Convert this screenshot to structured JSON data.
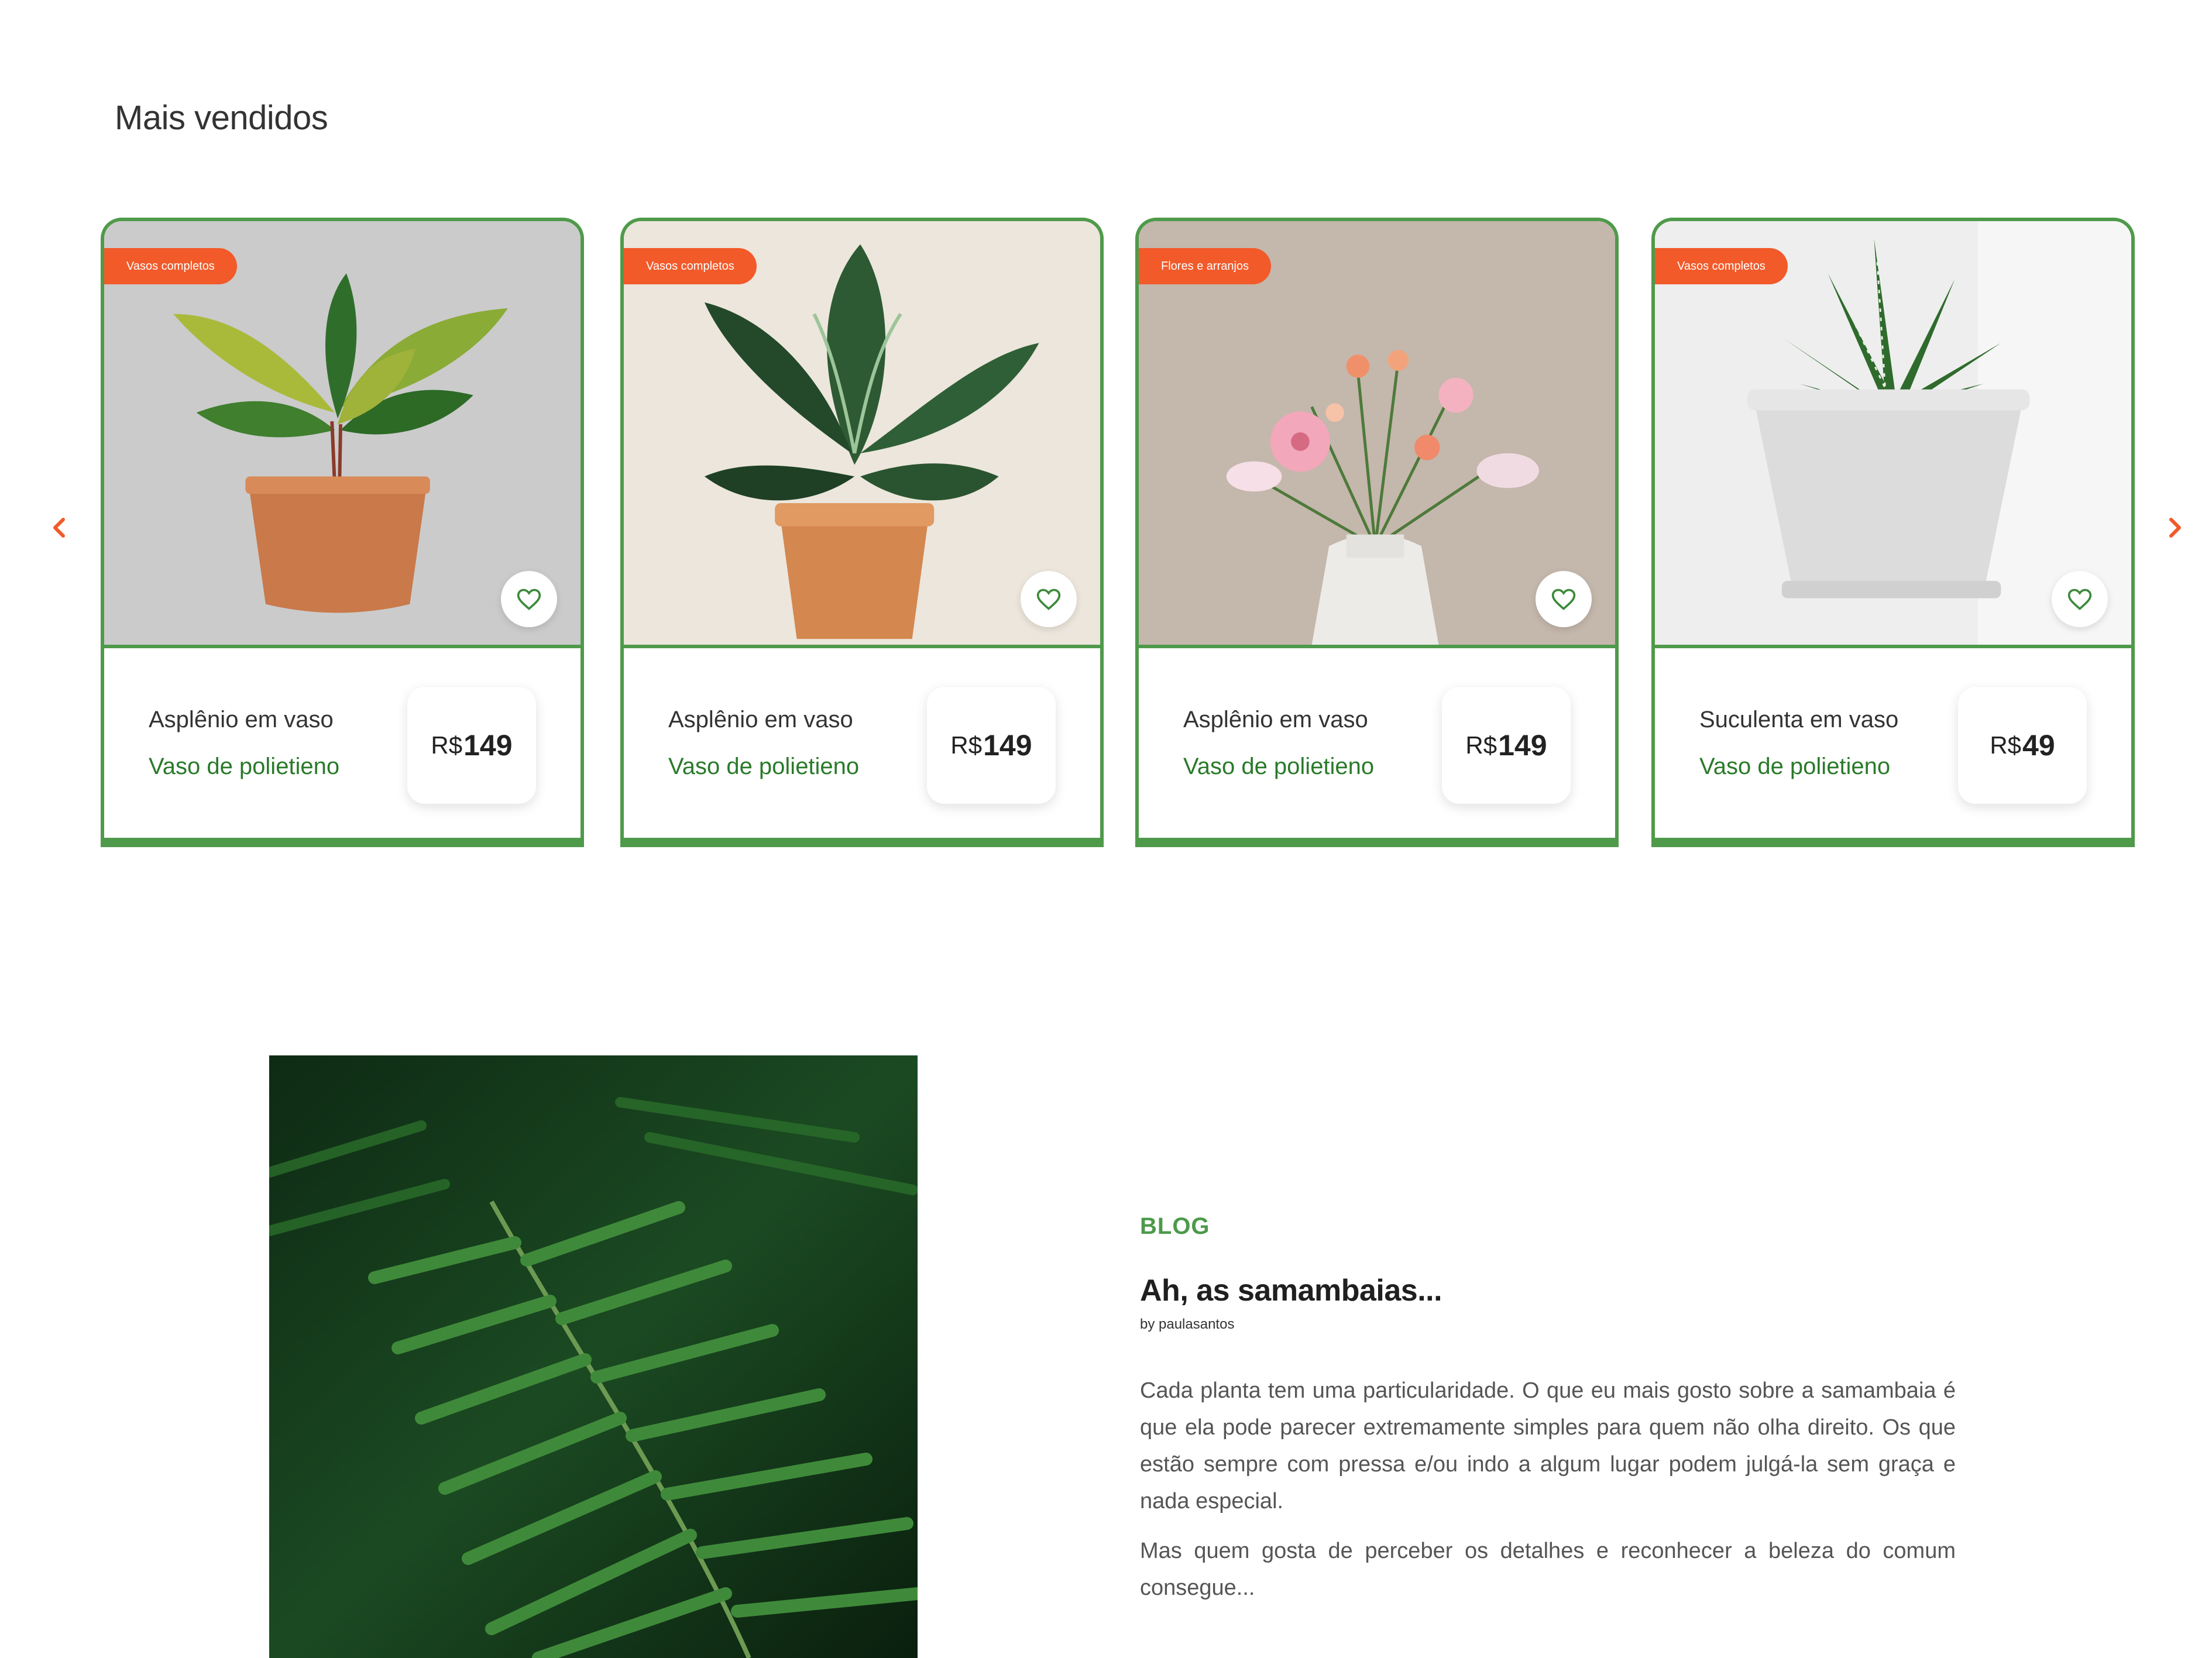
{
  "section": {
    "title": "Mais vendidos"
  },
  "products": [
    {
      "tag": "Vasos completos",
      "name": "Asplênio em vaso",
      "subtitle": "Vaso de polietieno",
      "currency": "R$",
      "price": "149",
      "image": "plant-in-terracotta-pot"
    },
    {
      "tag": "Vasos completos",
      "name": "Asplênio em vaso",
      "subtitle": "Vaso de polietieno",
      "currency": "R$",
      "price": "149",
      "image": "calathea-in-terracotta-pot"
    },
    {
      "tag": "Flores e arranjos",
      "name": "Asplênio em vaso",
      "subtitle": "Vaso de polietieno",
      "currency": "R$",
      "price": "149",
      "image": "flower-bouquet-in-vase"
    },
    {
      "tag": "Vasos completos",
      "name": "Suculenta em vaso",
      "subtitle": "Vaso de polietieno",
      "currency": "R$",
      "price": "49",
      "image": "succulent-in-white-pot"
    }
  ],
  "blog": {
    "label": "BLOG",
    "title": "Ah, as samambaias...",
    "author": "by paulasantos",
    "paragraphs": [
      "Cada planta tem uma particularidade. O que eu mais gosto sobre a samambaia é que ela pode parecer extremamente simples para quem não olha direito. Os que estão sempre com pressa e/ou indo a algum lugar podem julgá-la sem graça e nada especial.",
      "Mas quem gosta de perceber os detalhes e reconhecer a beleza do comum consegue..."
    ],
    "image": "fern-leaves-photo"
  },
  "icons": {
    "prev": "chevron-left-icon",
    "next": "chevron-right-icon",
    "favorite": "heart-icon"
  },
  "colors": {
    "accent": "#f25a2a",
    "brand_green": "#4f9a4a",
    "text_green": "#2a7a2a"
  }
}
